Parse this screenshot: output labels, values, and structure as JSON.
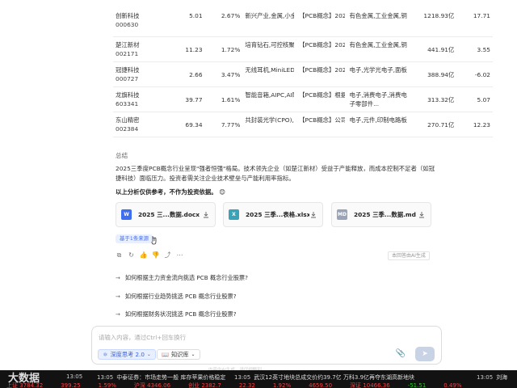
{
  "stocks": [
    {
      "name": "创新科技",
      "code": "000630",
      "price": "5.01",
      "change": "2.67%",
      "concept": "新兴产业,金属,小金属概念,...",
      "news": "【PCB概念】2025年5月14...",
      "industry": "有色金属,工业金属,铜",
      "mcap": "1218.93亿",
      "pct": "17.71"
    },
    {
      "name": "楚江新材",
      "code": "002171",
      "price": "11.23",
      "change": "1.72%",
      "concept": "培育钻石,可控核聚变,第三...",
      "news": "【PCB概念】2025年9月1日...",
      "industry": "有色金属,工业金属,铜",
      "mcap": "441.91亿",
      "pct": "3.55"
    },
    {
      "name": "冠捷科技",
      "code": "000727",
      "price": "2.66",
      "change": "3.47%",
      "concept": "无线耳机,MiniLED,智能穿...",
      "news": "【PCB概念】2022年10月1...",
      "industry": "电子,光学光电子,面板",
      "mcap": "388.94亿",
      "pct": "-6.02"
    },
    {
      "name": "龙旗科技",
      "code": "603341",
      "price": "39.77",
      "change": "1.61%",
      "concept": "智能音箱,AIPC,AI眼镜,无...",
      "news": "【PCB概念】根据招股说明...",
      "industry": "电子,消费电子,消费电子零部件...",
      "mcap": "313.32亿",
      "pct": "5.07"
    },
    {
      "name": "东山精密",
      "code": "002384",
      "price": "69.34",
      "change": "7.77%",
      "concept": "共封装光学(CPO),同花顺...",
      "news": "【PCB概念】公司完成现...",
      "industry": "电子,元件,印制电路板",
      "mcap": "270.71亿",
      "pct": "12.23"
    }
  ],
  "summary": {
    "title": "总结",
    "text": "2025三季度PCB概念行业呈现\"强者恒强\"格局。技术领先企业（如楚江新材）受益于产能释放，而成本控制不足者（如冠捷科技）面临压力。投资者需关注企业技术壁垒与产能利用率指标。",
    "disclaimer": "以上分析仅供参考，不作为投资依据。 😊"
  },
  "files": [
    {
      "badge": "W",
      "color": "#3e6ff0",
      "name": "2025 三...数据.docx"
    },
    {
      "badge": "X",
      "color": "#3aa3b8",
      "name": "2025 三季...表格.xlsx"
    },
    {
      "badge": "MD",
      "color": "#9aa3b8",
      "name": "2025 三季...数据.md"
    }
  ],
  "source_badge": "基于1条来源",
  "ai_note": "本回答由AI生成",
  "questions": [
    "如何根据主力资金流向挑选 PCB 概念行业股票?",
    "如何根据行业趋势挑选 PCB 概念行业股票?",
    "如何根据财务状况挑选 PCB 概念行业股票?"
  ],
  "input": {
    "placeholder": "请输入内容，通过Ctrl+回车换行",
    "deep_think": "深度思考 2.0",
    "knowledge": "知识库"
  },
  "footer_note": "内容由AI生成，请仔细甄别",
  "taskbar": {
    "logo": "大数据",
    "first_time": "13:05",
    "news": [
      {
        "time": "13:05",
        "text": "中泰证券：市场走势一般 库存苹果价格稳定"
      },
      {
        "time": "13:05",
        "text": "武汉12英寸地块总成交价约39.7亿 万科3.9亿再夺东湖高新地块"
      },
      {
        "time": "13:05",
        "text": "刘海"
      }
    ],
    "ticker": [
      "上证 3784.32",
      "399.25",
      "1.59%",
      "沪深 4346.06",
      "创业 2382.7",
      "22.32",
      "1.92%",
      "4659.50",
      "深证 10466.36",
      "-51.51",
      "0.49%"
    ]
  },
  "colors": {
    "accent": "#4a6fe0",
    "positive": "#e44444",
    "negative": "#22cc22"
  }
}
